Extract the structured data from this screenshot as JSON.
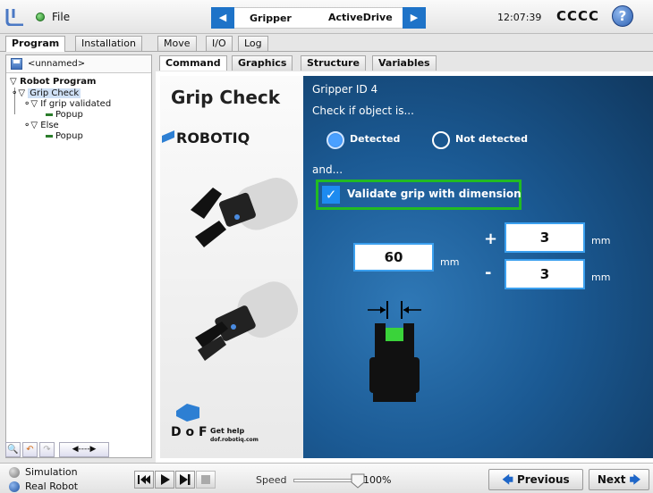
{
  "topbar": {
    "file_label": "File",
    "nav_left": "◀",
    "nav_right": "▶",
    "nav_gripper": "Gripper",
    "nav_active": "ActiveDrive",
    "clock": "12:07:39",
    "robot_name": "CCCC",
    "help": "?"
  },
  "main_tabs": [
    "Program",
    "Installation",
    "Move",
    "I/O",
    "Log"
  ],
  "tree": {
    "filename": "<unnamed>",
    "items": [
      "Robot Program",
      "Grip Check",
      "If grip validated",
      "Popup",
      "Else",
      "Popup"
    ]
  },
  "tree_toolbar": {
    "step_label": "◀----▶"
  },
  "sub_tabs": [
    "Command",
    "Graphics",
    "Structure",
    "Variables"
  ],
  "left_card": {
    "title": "Grip Check",
    "brand": "ROBOTIQ",
    "dof_letters": "D o F",
    "help_text": "Get help",
    "help_url": "dof.robotiq.com"
  },
  "grip": {
    "gripper_id": "Gripper ID 4",
    "check_label": "Check if object is...",
    "detected": "Detected",
    "not_detected": "Not detected",
    "and_label": "and...",
    "validate_label": "Validate grip with dimension",
    "validate_checked": true,
    "check_mark": "✓",
    "dimension": "60",
    "dimension_unit": "mm",
    "plus_sign": "+",
    "minus_sign": "-",
    "plus_tol": "3",
    "minus_tol": "3",
    "tol_unit": "mm"
  },
  "bottombar": {
    "simulation": "Simulation",
    "real_robot": "Real Robot",
    "speed_label": "Speed",
    "speed_value": "100%",
    "speed_fraction": 1.0,
    "previous": "Previous",
    "next": "Next"
  },
  "colors": {
    "accent_blue": "#1e73c8",
    "validate_border": "#22bb22",
    "panel_blue": "#1b5a94"
  }
}
